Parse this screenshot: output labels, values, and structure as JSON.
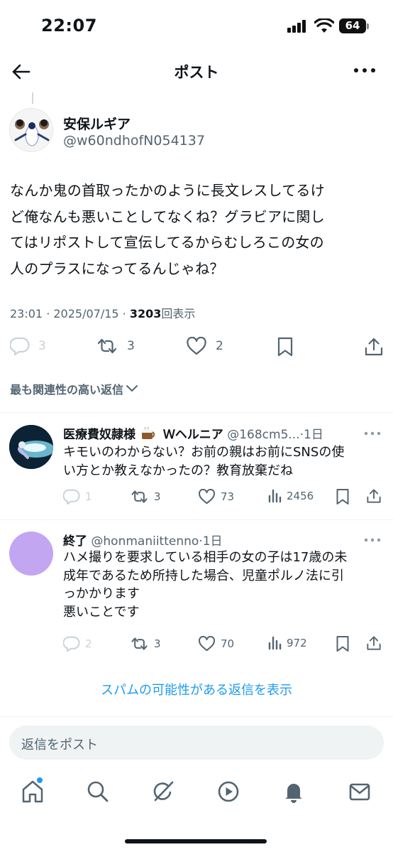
{
  "status_bar": {
    "time": "22:07",
    "battery": "64"
  },
  "header": {
    "title": "ポスト"
  },
  "post": {
    "author_name": "安保ルギア",
    "author_handle": "@w60ndhofN054137",
    "text_lines": [
      "なんか鬼の首取ったかのように長文レスしてるけ",
      "ど俺なんも悪いことしてなくね？グラビアに関し",
      "てはリポストして宣伝してるからむしろこの女の",
      "人のプラスになってるんじゃね？"
    ],
    "timestamp": "23:01 · 2025/07/15 · ",
    "views": "3203",
    "views_label": "回表示",
    "reply_count": "3",
    "repost_count": "3",
    "like_count": "2"
  },
  "sort_label": "最も関連性の高い返信",
  "replies": [
    {
      "name": "医療費奴隷様",
      "name_suffix": "Ｗヘルニア",
      "handle": "@168cm5...",
      "time": "·1日",
      "text_lines": [
        "キモいのわからない？お前の親はお前にSNSの使",
        "い方とか教えなかったの？教育放棄だね"
      ],
      "reply_count": "1",
      "repost_count": "3",
      "like_count": "73",
      "view_count": "2456"
    },
    {
      "name": "終了",
      "name_suffix": "",
      "handle": "@honmaniittenno",
      "time": "·1日",
      "text_lines": [
        "ハメ撮りを要求している相手の女の子は17歳の未",
        "成年であるため所持した場合、児童ポルノ法に引",
        "っかかります",
        "悪いことです"
      ],
      "reply_count": "2",
      "repost_count": "3",
      "like_count": "70",
      "view_count": "972",
      "avatar_color": "#c3a6f2"
    }
  ],
  "spam_link": "スパムの可能性がある返信を表示",
  "reply_placeholder": "返信をポスト",
  "icons": [
    "back-arrow-icon",
    "more-icon",
    "reply-icon",
    "repost-icon",
    "like-icon",
    "bookmark-icon",
    "share-icon",
    "views-icon",
    "home-icon",
    "search-icon",
    "grok-icon",
    "video-icon",
    "notifications-icon",
    "messages-icon"
  ]
}
